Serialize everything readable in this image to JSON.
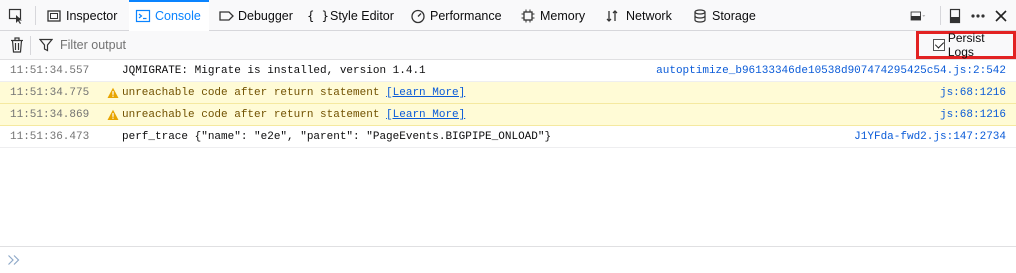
{
  "toolbar": {
    "tabs": [
      {
        "label": "Inspector",
        "icon": "inspector-icon"
      },
      {
        "label": "Console",
        "icon": "console-icon",
        "selected": true
      },
      {
        "label": "Debugger",
        "icon": "debugger-icon"
      },
      {
        "label": "Style Editor",
        "icon": "braces-icon"
      },
      {
        "label": "Performance",
        "icon": "performance-icon"
      },
      {
        "label": "Memory",
        "icon": "memory-icon"
      },
      {
        "label": "Network",
        "icon": "network-icon"
      },
      {
        "label": "Storage",
        "icon": "storage-icon"
      }
    ],
    "accent": "#0a84ff"
  },
  "filterbar": {
    "placeholder": "Filter output",
    "persist_logs_label": "Persist Logs",
    "persist_logs_checked": true
  },
  "messages": [
    {
      "time": "11:51:34.557",
      "level": "log",
      "text": "JQMIGRATE: Migrate is installed, version 1.4.1",
      "source": "autoptimize_b96133346de10538d907474295425c54.js:2:542"
    },
    {
      "time": "11:51:34.775",
      "level": "warning",
      "text": "unreachable code after return statement ",
      "link": "[Learn More]",
      "source": "js:68:1216"
    },
    {
      "time": "11:51:34.869",
      "level": "warning",
      "text": "unreachable code after return statement ",
      "link": "[Learn More]",
      "source": "js:68:1216"
    },
    {
      "time": "11:51:36.473",
      "level": "log",
      "text": "perf_trace {\"name\": \"e2e\", \"parent\": \"PageEvents.BIGPIPE_ONLOAD\"}",
      "source": "J1YFda-fwd2.js:147:2734"
    }
  ],
  "colors": {
    "warning_bg": "#fffbd6",
    "highlight_box": "#e22222",
    "link": "#0a5bd8"
  }
}
